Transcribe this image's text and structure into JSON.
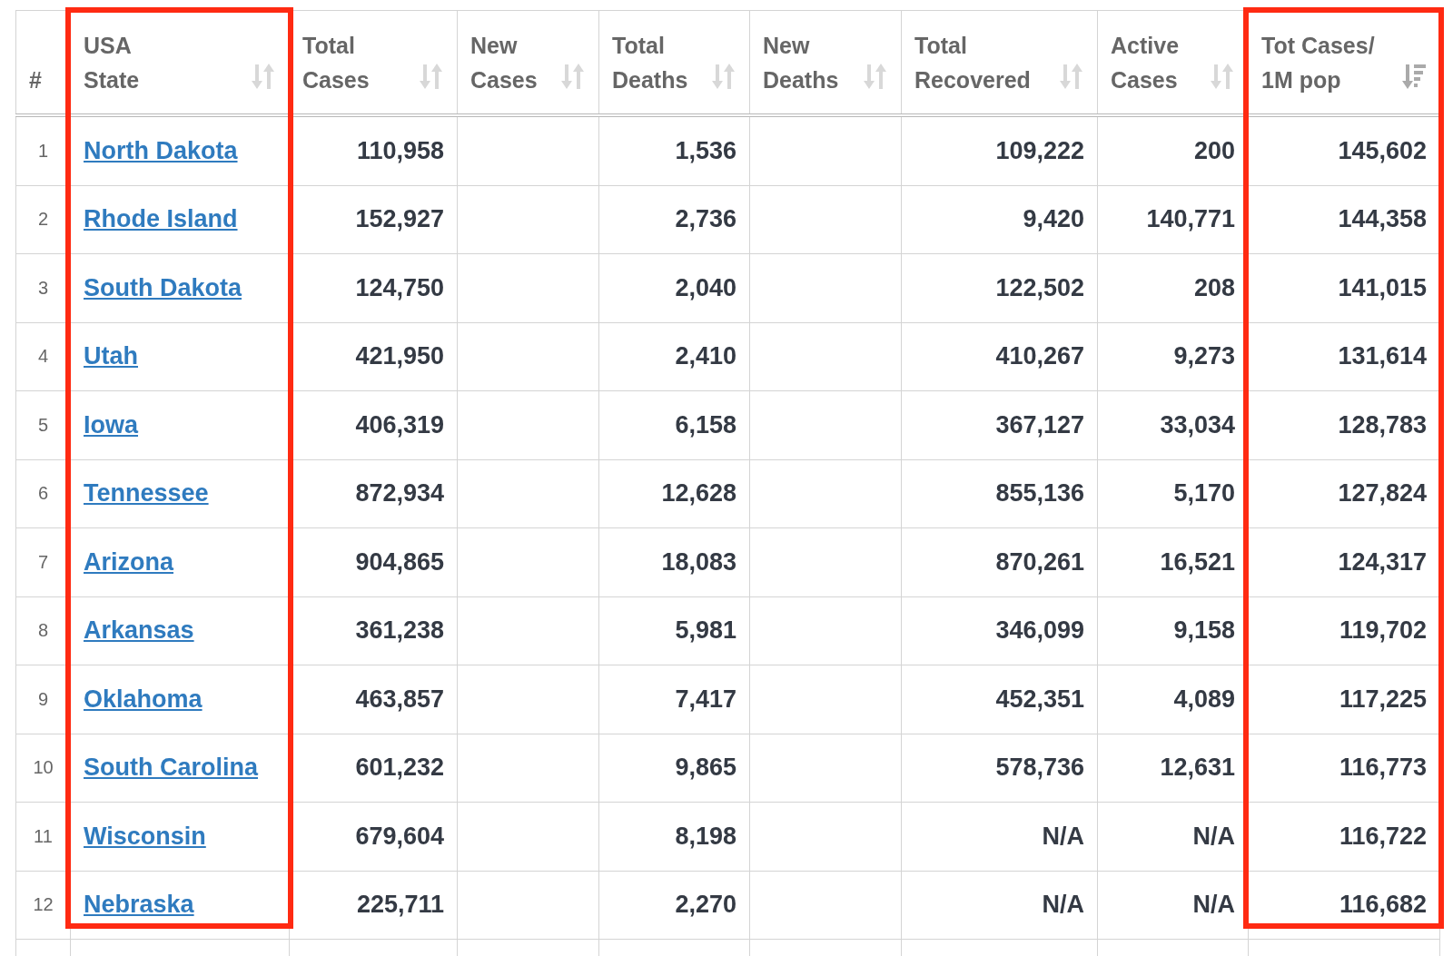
{
  "table": {
    "columns": [
      {
        "label": "#",
        "sortable": false
      },
      {
        "label": "USA\nState",
        "sortable": true,
        "sorted": false,
        "highlighted": true
      },
      {
        "label": "Total\nCases",
        "sortable": true,
        "sorted": false,
        "highlighted": false
      },
      {
        "label": "New\nCases",
        "sortable": true,
        "sorted": false,
        "highlighted": false
      },
      {
        "label": "Total\nDeaths",
        "sortable": true,
        "sorted": false,
        "highlighted": false
      },
      {
        "label": "New\nDeaths",
        "sortable": true,
        "sorted": false,
        "highlighted": false
      },
      {
        "label": "Total\nRecovered",
        "sortable": true,
        "sorted": false,
        "highlighted": false
      },
      {
        "label": "Active\nCases",
        "sortable": true,
        "sorted": false,
        "highlighted": false
      },
      {
        "label": "Tot Cases/\n1M pop",
        "sortable": true,
        "sorted": true,
        "highlighted": true
      }
    ],
    "rows": [
      {
        "rank": "1",
        "state": "North Dakota",
        "total_cases": "110,958",
        "total_deaths": "1,536",
        "total_recovered": "109,222",
        "active_cases": "200",
        "cases_per_1m": "145,602"
      },
      {
        "rank": "2",
        "state": "Rhode Island",
        "total_cases": "152,927",
        "total_deaths": "2,736",
        "total_recovered": "9,420",
        "active_cases": "140,771",
        "cases_per_1m": "144,358"
      },
      {
        "rank": "3",
        "state": "South Dakota",
        "total_cases": "124,750",
        "total_deaths": "2,040",
        "total_recovered": "122,502",
        "active_cases": "208",
        "cases_per_1m": "141,015"
      },
      {
        "rank": "4",
        "state": "Utah",
        "total_cases": "421,950",
        "total_deaths": "2,410",
        "total_recovered": "410,267",
        "active_cases": "9,273",
        "cases_per_1m": "131,614"
      },
      {
        "rank": "5",
        "state": "Iowa",
        "total_cases": "406,319",
        "total_deaths": "6,158",
        "total_recovered": "367,127",
        "active_cases": "33,034",
        "cases_per_1m": "128,783"
      },
      {
        "rank": "6",
        "state": "Tennessee",
        "total_cases": "872,934",
        "total_deaths": "12,628",
        "total_recovered": "855,136",
        "active_cases": "5,170",
        "cases_per_1m": "127,824"
      },
      {
        "rank": "7",
        "state": "Arizona",
        "total_cases": "904,865",
        "total_deaths": "18,083",
        "total_recovered": "870,261",
        "active_cases": "16,521",
        "cases_per_1m": "124,317"
      },
      {
        "rank": "8",
        "state": "Arkansas",
        "total_cases": "361,238",
        "total_deaths": "5,981",
        "total_recovered": "346,099",
        "active_cases": "9,158",
        "cases_per_1m": "119,702"
      },
      {
        "rank": "9",
        "state": "Oklahoma",
        "total_cases": "463,857",
        "total_deaths": "7,417",
        "total_recovered": "452,351",
        "active_cases": "4,089",
        "cases_per_1m": "117,225"
      },
      {
        "rank": "10",
        "state": "South Carolina",
        "total_cases": "601,232",
        "total_deaths": "9,865",
        "total_recovered": "578,736",
        "active_cases": "12,631",
        "cases_per_1m": "116,773"
      },
      {
        "rank": "11",
        "state": "Wisconsin",
        "total_cases": "679,604",
        "total_deaths": "8,198",
        "total_recovered": "N/A",
        "active_cases": "N/A",
        "cases_per_1m": "116,722"
      },
      {
        "rank": "12",
        "state": "Nebraska",
        "total_cases": "225,711",
        "total_deaths": "2,270",
        "total_recovered": "N/A",
        "active_cases": "N/A",
        "cases_per_1m": "116,682"
      }
    ]
  }
}
